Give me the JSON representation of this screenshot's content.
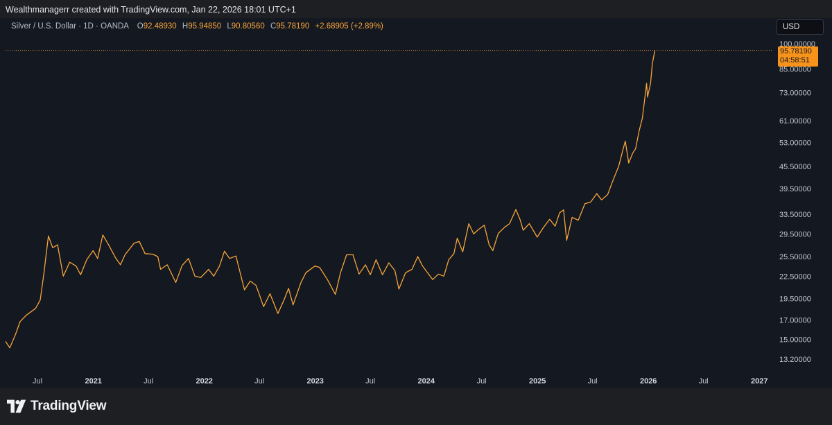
{
  "header": {
    "attribution": "Wealthmanagerr created with TradingView.com, Jan 22, 2026 18:01 UTC+1"
  },
  "legend": {
    "symbol": "Silver / U.S. Dollar · 1D · OANDA",
    "open_key": "O",
    "open": "92.48930",
    "high_key": "H",
    "high": "95.94850",
    "low_key": "L",
    "low": "90.80560",
    "close_key": "C",
    "close": "95.78190",
    "change": "+2.68905 (+2.89%)"
  },
  "currency_button": "USD",
  "price_tag": {
    "price": "95.78190",
    "countdown": "04:58:51"
  },
  "footer": {
    "brand": "TradingView"
  },
  "colors": {
    "background": "#141821",
    "series": "#f7a53a",
    "price_tag": "#f7931a",
    "dashed_line": "#e8913a"
  },
  "chart_data": {
    "type": "line",
    "title": "",
    "scale": "log",
    "ylim": [
      12.3,
      105
    ],
    "xlim": [
      "2020-03-18",
      "2027-02-15"
    ],
    "current_price": 95.7819,
    "y_ticks": [
      {
        "label": "100.00000",
        "value": 100
      },
      {
        "label": "85.00000",
        "value": 85
      },
      {
        "label": "73.00000",
        "value": 73
      },
      {
        "label": "61.00000",
        "value": 61
      },
      {
        "label": "53.00000",
        "value": 53
      },
      {
        "label": "45.50000",
        "value": 45.5
      },
      {
        "label": "39.50000",
        "value": 39.5
      },
      {
        "label": "33.50000",
        "value": 33.5
      },
      {
        "label": "29.50000",
        "value": 29.5
      },
      {
        "label": "25.50000",
        "value": 25.5
      },
      {
        "label": "22.50000",
        "value": 22.5
      },
      {
        "label": "19.50000",
        "value": 19.5
      },
      {
        "label": "17.00000",
        "value": 17
      },
      {
        "label": "15.00000",
        "value": 15
      },
      {
        "label": "13.20000",
        "value": 13.2
      }
    ],
    "x_ticks": [
      {
        "label": "Jul",
        "date": "2020-07-01",
        "bold": false
      },
      {
        "label": "2021",
        "date": "2021-01-01",
        "bold": true
      },
      {
        "label": "Jul",
        "date": "2021-07-01",
        "bold": false
      },
      {
        "label": "2022",
        "date": "2022-01-01",
        "bold": true
      },
      {
        "label": "Jul",
        "date": "2022-07-01",
        "bold": false
      },
      {
        "label": "2023",
        "date": "2023-01-01",
        "bold": true
      },
      {
        "label": "Jul",
        "date": "2023-07-01",
        "bold": false
      },
      {
        "label": "2024",
        "date": "2024-01-01",
        "bold": true
      },
      {
        "label": "Jul",
        "date": "2024-07-01",
        "bold": false
      },
      {
        "label": "2025",
        "date": "2025-01-01",
        "bold": true
      },
      {
        "label": "Jul",
        "date": "2025-07-01",
        "bold": false
      },
      {
        "label": "2026",
        "date": "2026-01-01",
        "bold": true
      },
      {
        "label": "Jul",
        "date": "2026-07-01",
        "bold": false
      },
      {
        "label": "2027",
        "date": "2027-01-01",
        "bold": true
      }
    ],
    "series": [
      {
        "points": [
          [
            "2020-03-18",
            14.8
          ],
          [
            "2020-04-01",
            14.2
          ],
          [
            "2020-04-20",
            15.5
          ],
          [
            "2020-05-05",
            16.8
          ],
          [
            "2020-05-25",
            17.5
          ],
          [
            "2020-06-10",
            17.9
          ],
          [
            "2020-06-25",
            18.3
          ],
          [
            "2020-07-10",
            19.3
          ],
          [
            "2020-07-22",
            22.8
          ],
          [
            "2020-08-06",
            29.1
          ],
          [
            "2020-08-20",
            27.0
          ],
          [
            "2020-09-05",
            27.5
          ],
          [
            "2020-09-24",
            22.5
          ],
          [
            "2020-10-15",
            24.6
          ],
          [
            "2020-11-05",
            24.0
          ],
          [
            "2020-11-20",
            22.7
          ],
          [
            "2020-12-10",
            25.0
          ],
          [
            "2020-12-31",
            26.5
          ],
          [
            "2021-01-15",
            25.2
          ],
          [
            "2021-02-01",
            29.3
          ],
          [
            "2021-02-20",
            27.5
          ],
          [
            "2021-03-15",
            25.3
          ],
          [
            "2021-03-31",
            24.2
          ],
          [
            "2021-04-15",
            25.8
          ],
          [
            "2021-05-15",
            27.8
          ],
          [
            "2021-06-01",
            28.1
          ],
          [
            "2021-06-20",
            26.0
          ],
          [
            "2021-07-15",
            25.9
          ],
          [
            "2021-08-01",
            25.5
          ],
          [
            "2021-08-10",
            23.5
          ],
          [
            "2021-09-01",
            24.2
          ],
          [
            "2021-09-29",
            21.6
          ],
          [
            "2021-10-20",
            24.1
          ],
          [
            "2021-11-10",
            25.2
          ],
          [
            "2021-12-01",
            22.5
          ],
          [
            "2021-12-20",
            22.3
          ],
          [
            "2022-01-15",
            23.5
          ],
          [
            "2022-02-01",
            22.5
          ],
          [
            "2022-02-20",
            24.0
          ],
          [
            "2022-03-08",
            26.4
          ],
          [
            "2022-03-25",
            25.2
          ],
          [
            "2022-04-15",
            25.6
          ],
          [
            "2022-05-13",
            20.6
          ],
          [
            "2022-06-01",
            21.8
          ],
          [
            "2022-06-20",
            21.2
          ],
          [
            "2022-07-15",
            18.5
          ],
          [
            "2022-08-05",
            20.1
          ],
          [
            "2022-08-31",
            17.7
          ],
          [
            "2022-09-20",
            19.3
          ],
          [
            "2022-10-05",
            20.8
          ],
          [
            "2022-10-20",
            18.7
          ],
          [
            "2022-11-15",
            21.6
          ],
          [
            "2022-12-01",
            23.0
          ],
          [
            "2022-12-31",
            24.0
          ],
          [
            "2023-01-15",
            23.8
          ],
          [
            "2023-02-10",
            22.0
          ],
          [
            "2023-03-08",
            20.0
          ],
          [
            "2023-03-25",
            23.0
          ],
          [
            "2023-04-14",
            25.8
          ],
          [
            "2023-05-05",
            25.8
          ],
          [
            "2023-05-25",
            22.8
          ],
          [
            "2023-06-15",
            24.2
          ],
          [
            "2023-07-01",
            22.7
          ],
          [
            "2023-07-20",
            25.0
          ],
          [
            "2023-08-10",
            22.7
          ],
          [
            "2023-08-31",
            24.5
          ],
          [
            "2023-09-20",
            23.3
          ],
          [
            "2023-10-03",
            20.7
          ],
          [
            "2023-10-25",
            23.0
          ],
          [
            "2023-11-15",
            23.5
          ],
          [
            "2023-12-04",
            25.5
          ],
          [
            "2023-12-20",
            24.0
          ],
          [
            "2024-01-22",
            22.0
          ],
          [
            "2024-02-10",
            22.8
          ],
          [
            "2024-02-28",
            22.5
          ],
          [
            "2024-03-15",
            25.0
          ],
          [
            "2024-04-01",
            26.0
          ],
          [
            "2024-04-12",
            28.7
          ],
          [
            "2024-04-30",
            26.3
          ],
          [
            "2024-05-20",
            31.5
          ],
          [
            "2024-06-05",
            29.5
          ],
          [
            "2024-06-20",
            30.3
          ],
          [
            "2024-07-10",
            31.2
          ],
          [
            "2024-07-26",
            27.5
          ],
          [
            "2024-08-07",
            26.5
          ],
          [
            "2024-08-25",
            29.6
          ],
          [
            "2024-09-15",
            30.8
          ],
          [
            "2024-10-01",
            31.5
          ],
          [
            "2024-10-22",
            34.5
          ],
          [
            "2024-11-05",
            32.3
          ],
          [
            "2024-11-15",
            30.2
          ],
          [
            "2024-12-05",
            31.5
          ],
          [
            "2024-12-31",
            28.9
          ],
          [
            "2025-01-20",
            30.7
          ],
          [
            "2025-02-10",
            32.4
          ],
          [
            "2025-02-28",
            31.0
          ],
          [
            "2025-03-15",
            33.8
          ],
          [
            "2025-03-28",
            34.4
          ],
          [
            "2025-04-07",
            28.3
          ],
          [
            "2025-04-25",
            32.8
          ],
          [
            "2025-05-15",
            32.2
          ],
          [
            "2025-06-06",
            35.8
          ],
          [
            "2025-06-25",
            36.2
          ],
          [
            "2025-07-15",
            38.2
          ],
          [
            "2025-07-31",
            36.7
          ],
          [
            "2025-08-20",
            38.0
          ],
          [
            "2025-09-05",
            41.3
          ],
          [
            "2025-09-25",
            45.5
          ],
          [
            "2025-10-10",
            51.0
          ],
          [
            "2025-10-17",
            53.5
          ],
          [
            "2025-10-28",
            46.5
          ],
          [
            "2025-11-10",
            49.5
          ],
          [
            "2025-11-20",
            51.0
          ],
          [
            "2025-12-01",
            57.0
          ],
          [
            "2025-12-12",
            62.0
          ],
          [
            "2025-12-26",
            77.5
          ],
          [
            "2025-12-29",
            71.0
          ],
          [
            "2026-01-08",
            77.5
          ],
          [
            "2026-01-14",
            88.0
          ],
          [
            "2026-01-22",
            95.7819
          ]
        ]
      }
    ]
  }
}
